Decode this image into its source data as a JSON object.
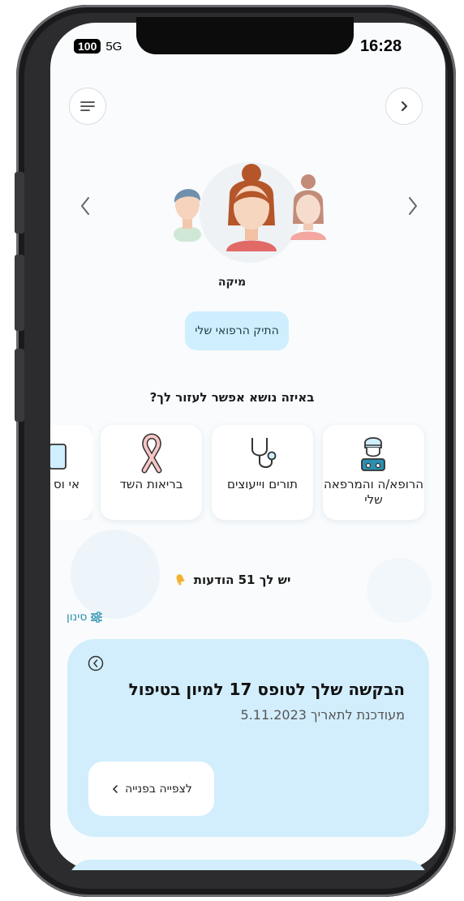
{
  "status": {
    "battery": "100",
    "network": "5G",
    "time": "16:28"
  },
  "profile": {
    "name": "מיקה",
    "medical_file_button": "התיק הרפואי שלי"
  },
  "help_question": "באיזה נושא אפשר לעזור לך?",
  "topics": [
    {
      "label": "הרופא/ה והמרפאה שלי",
      "icon": "doctor-icon"
    },
    {
      "label": "תורים וייעוצים",
      "icon": "stethoscope-icon"
    },
    {
      "label": "בריאות השד",
      "icon": "ribbon-icon"
    },
    {
      "label": "אי וס",
      "icon": "document-icon"
    }
  ],
  "notifications": {
    "text": "יש לך 51 הודעות",
    "icon": "bell-icon"
  },
  "filter_label": "סינון",
  "message": {
    "title": "הבקשה שלך לטופס 17 למיון בטיפול",
    "date": "מעודכנת לתאריך 5.11.2023",
    "button": "לצפייה בפנייה"
  },
  "colors": {
    "accent": "#2a8fb0",
    "card_bg": "#d2eefc",
    "pill_bg": "#cfeefe"
  }
}
